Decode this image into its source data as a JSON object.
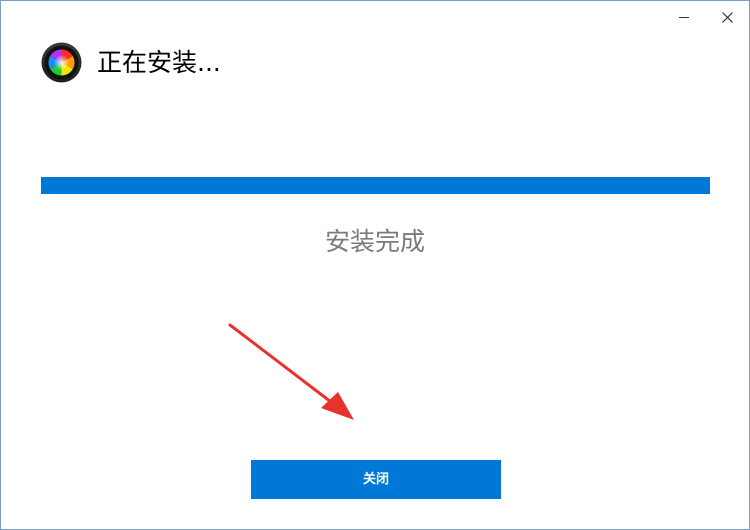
{
  "window": {
    "title": "正在安装...",
    "minimize_icon": "minimize-icon",
    "close_icon": "close-icon",
    "app_icon": "color-wheel-icon"
  },
  "progress": {
    "percent": 100,
    "color": "#0078d7",
    "track_color": "#e6e6e6"
  },
  "status": {
    "text": "安装完成"
  },
  "annotation": {
    "arrow_color": "#e8322e"
  },
  "actions": {
    "close_label": "关闭",
    "button_color": "#0078d7"
  }
}
